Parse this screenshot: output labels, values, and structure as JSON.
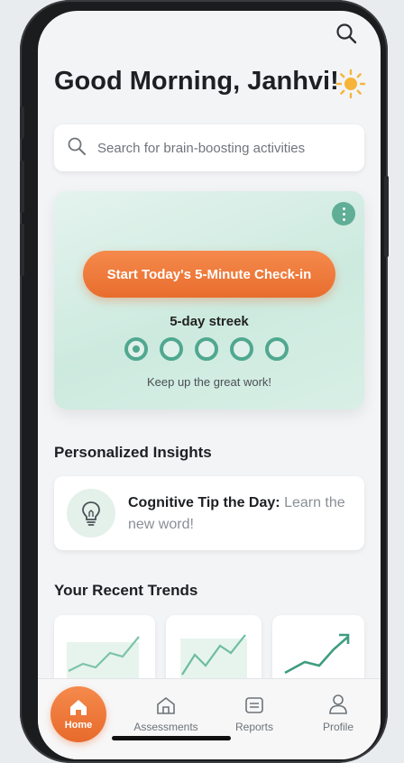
{
  "header": {
    "greeting": "Good Morning, Janhvi!",
    "search_icon": "search-icon",
    "weather_icon": "sun-icon"
  },
  "search": {
    "placeholder": "Search for brain-boosting activities"
  },
  "hero": {
    "cta_label": "Start Today's 5-Minute Check-in",
    "streak_label": "5-day streek",
    "streak_days_total": 5,
    "streak_days_active": 1,
    "encouragement": "Keep up the great work!",
    "menu_icon": "more-vertical-icon"
  },
  "insights": {
    "title": "Personalized Insights",
    "tip_label": "Cognitive Tip the Day:",
    "tip_text": "Learn the new word!",
    "icon": "lightbulb-icon"
  },
  "trends": {
    "title": "Your Recent Trends"
  },
  "nav": {
    "items": [
      {
        "label": "Home",
        "icon": "home-icon",
        "active": true
      },
      {
        "label": "Assessments",
        "icon": "assessments-icon",
        "active": false
      },
      {
        "label": "Reports",
        "icon": "reports-icon",
        "active": false
      },
      {
        "label": "Profile",
        "icon": "profile-icon",
        "active": false
      }
    ]
  },
  "colors": {
    "accent": "#e86d2e",
    "teal": "#4fa88f",
    "hero_bg": "#cdeadf"
  }
}
